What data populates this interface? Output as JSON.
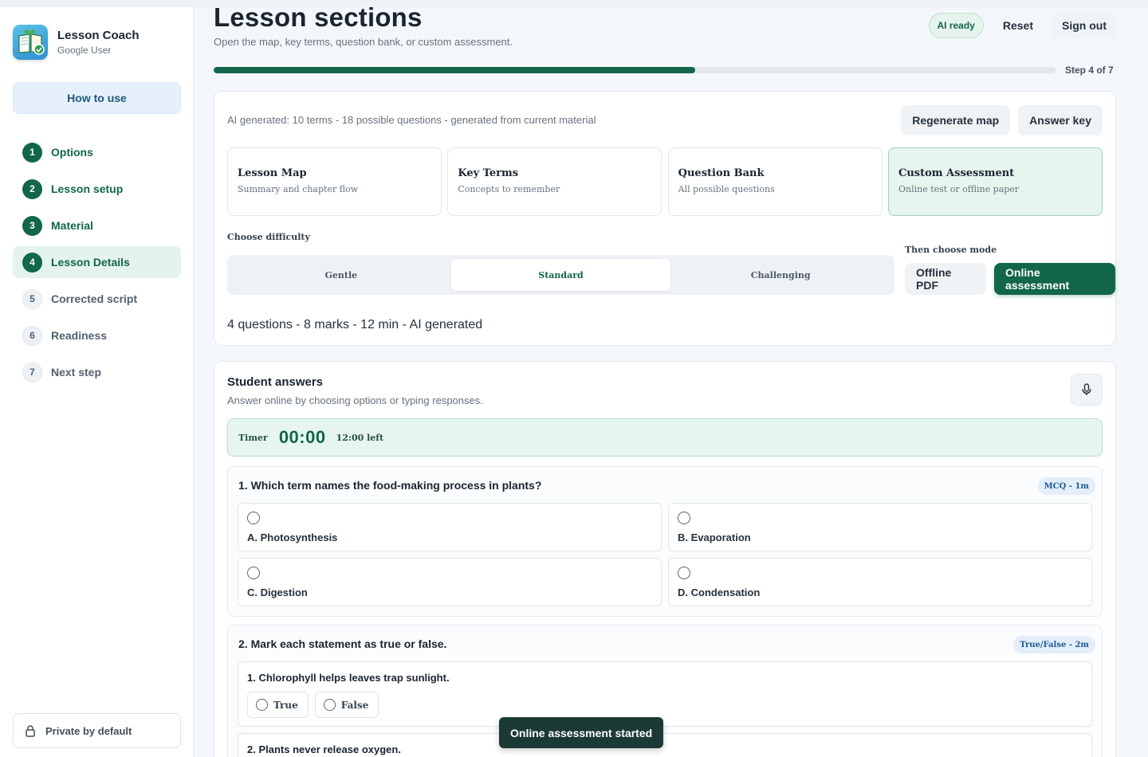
{
  "app": {
    "title": "Lesson Coach",
    "user": "Google User"
  },
  "sidebar": {
    "how_to_use": "How to use",
    "steps": [
      {
        "num": "1",
        "label": "Options",
        "state": "done"
      },
      {
        "num": "2",
        "label": "Lesson setup",
        "state": "done"
      },
      {
        "num": "3",
        "label": "Material",
        "state": "done"
      },
      {
        "num": "4",
        "label": "Lesson Details",
        "state": "active"
      },
      {
        "num": "5",
        "label": "Corrected script",
        "state": "todo"
      },
      {
        "num": "6",
        "label": "Readiness",
        "state": "todo"
      },
      {
        "num": "7",
        "label": "Next step",
        "state": "todo"
      }
    ],
    "private_label": "Private by default"
  },
  "header": {
    "title": "Lesson sections",
    "subtitle": "Open the map, key terms, question bank, or custom assessment.",
    "ai_status": "AI ready",
    "reset_label": "Reset",
    "signout_label": "Sign out"
  },
  "progress": {
    "label": "Step 4 of 7",
    "fraction": 0.572
  },
  "sections": {
    "ai_info": "AI generated: 10 terms - 18 possible questions - generated from current material",
    "regenerate_label": "Regenerate map",
    "answer_key_label": "Answer key",
    "tiles": [
      {
        "title": "Lesson Map",
        "subtitle": "Summary and chapter flow",
        "active": false
      },
      {
        "title": "Key Terms",
        "subtitle": "Concepts to remember",
        "active": false
      },
      {
        "title": "Question Bank",
        "subtitle": "All possible questions",
        "active": false
      },
      {
        "title": "Custom Assessment",
        "subtitle": "Online test or offline paper",
        "active": true
      }
    ],
    "difficulty_label": "Choose difficulty",
    "difficulties": [
      "Gentle",
      "Standard",
      "Challenging"
    ],
    "selected_difficulty": "Standard",
    "mode_label": "Then choose mode",
    "mode_pdf": "Offline PDF",
    "mode_online": "Online assessment",
    "summary": "4 questions - 8 marks - 12 min - AI generated"
  },
  "answers": {
    "title": "Student answers",
    "subtitle": "Answer online by choosing options or typing responses.",
    "timer_label": "Timer",
    "timer_value": "00:00",
    "timer_left": "12:00 left",
    "questions": [
      {
        "title": "1. Which term names the food-making process in plants?",
        "tag": "MCQ - 1m",
        "options": [
          "A. Photosynthesis",
          "B. Evaporation",
          "C. Digestion",
          "D. Condensation"
        ]
      },
      {
        "title": "2. Mark each statement as true or false.",
        "tag": "True/False - 2m",
        "statements": [
          "1. Chlorophyll helps leaves trap sunlight.",
          "2. Plants never release oxygen."
        ],
        "true_label": "True",
        "false_label": "False"
      }
    ]
  },
  "toast": "Online assessment started",
  "colors": {
    "brand_green": "#12664a",
    "active_bg": "#e4f3ec",
    "tag_blue": "#1e5b94"
  }
}
